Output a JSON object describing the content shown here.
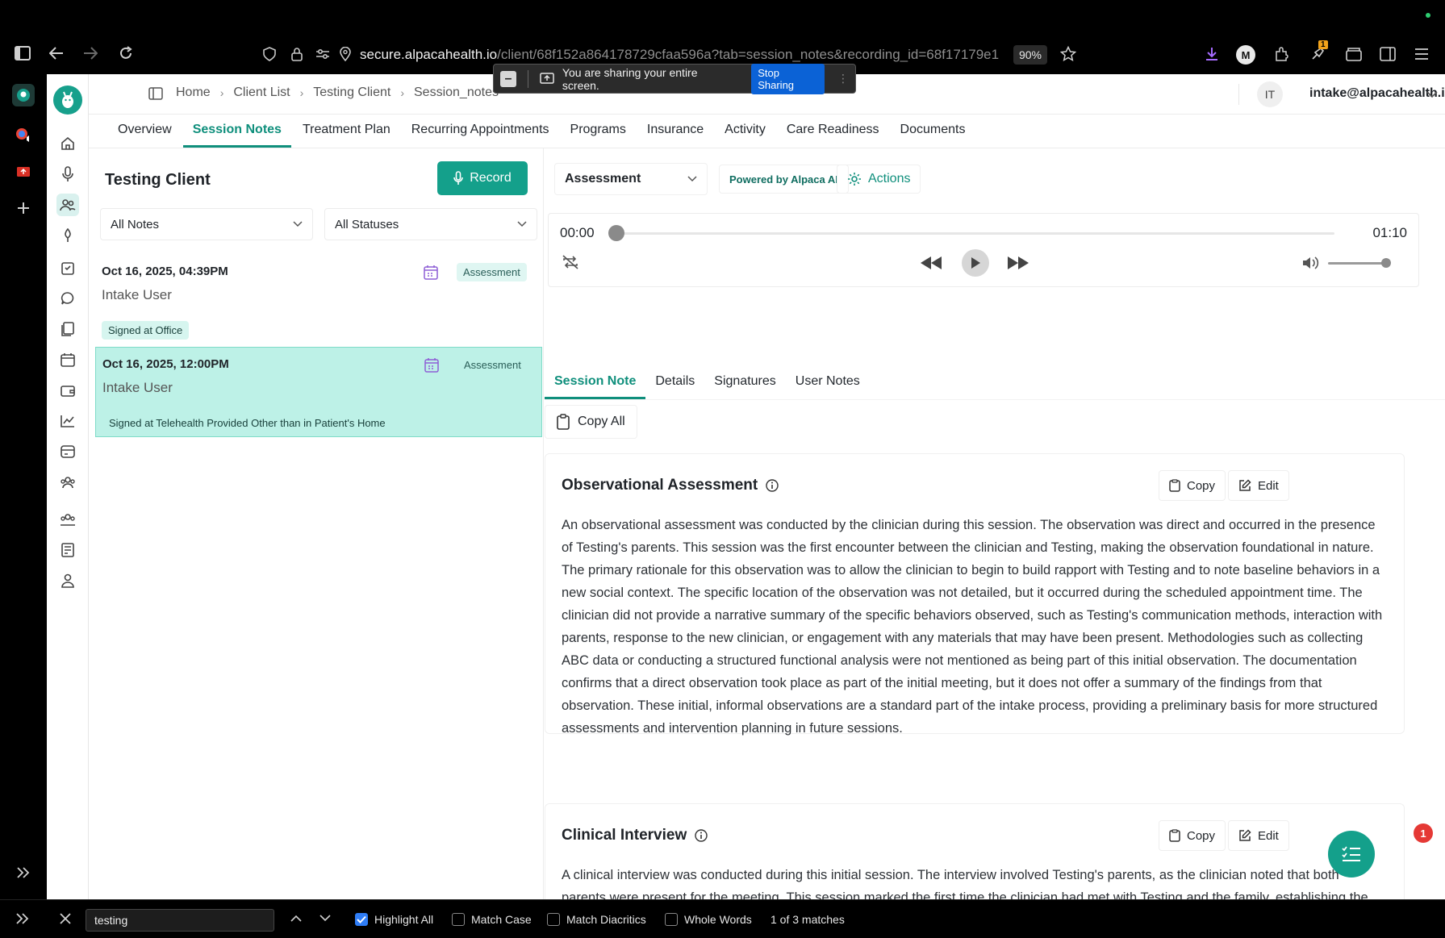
{
  "browser": {
    "url_host": "secure.alpacahealth.io",
    "url_path": "/client/68f152a864178729cfaa596a?tab=session_notes&recording_id=68f17179e1",
    "zoom": "90%",
    "profile_initial": "M",
    "extension_badge": "1"
  },
  "sharing": {
    "message": "You are sharing your entire screen.",
    "stop_label": "Stop Sharing"
  },
  "breadcrumb": {
    "home": "Home",
    "client_list": "Client List",
    "client": "Testing Client",
    "page": "Session_notes"
  },
  "user": {
    "initials": "IT",
    "email": "intake@alpacahealth.io"
  },
  "tabs": [
    {
      "label": "Overview"
    },
    {
      "label": "Session Notes"
    },
    {
      "label": "Treatment Plan"
    },
    {
      "label": "Recurring Appointments"
    },
    {
      "label": "Programs"
    },
    {
      "label": "Insurance"
    },
    {
      "label": "Activity"
    },
    {
      "label": "Care Readiness"
    },
    {
      "label": "Documents"
    }
  ],
  "left": {
    "client_name": "Testing Client",
    "record_label": "Record",
    "notes_filter": "All Notes",
    "status_filter": "All Statuses",
    "notes": [
      {
        "date": "Oct 16, 2025, 04:39PM",
        "user": "Intake User",
        "type": "Assessment",
        "status": "Signed at Office"
      },
      {
        "date": "Oct 16, 2025, 12:00PM",
        "user": "Intake User",
        "type": "Assessment",
        "status": "Signed at Telehealth Provided Other than in Patient's Home"
      }
    ]
  },
  "right": {
    "note_type": "Assessment",
    "powered_by": "Powered by Alpaca AI",
    "actions_label": "Actions",
    "player": {
      "current": "00:00",
      "duration": "01:10",
      "progress": 0.0,
      "volume": 1.0
    },
    "subtabs": [
      {
        "label": "Session Note"
      },
      {
        "label": "Details"
      },
      {
        "label": "Signatures"
      },
      {
        "label": "User Notes"
      }
    ],
    "copy_all_label": "Copy All",
    "copy_label": "Copy",
    "edit_label": "Edit",
    "sections": [
      {
        "title": "Observational Assessment",
        "body": "An observational assessment was conducted by the clinician during this session. The observation was direct and occurred in the presence of Testing's parents. This session was the first encounter between the clinician and Testing, making the observation foundational in nature. The primary rationale for this observation was to allow the clinician to begin to build rapport with Testing and to note baseline behaviors in a new social context. The specific location of the observation was not detailed, but it occurred during the scheduled appointment time. The clinician did not provide a narrative summary of the specific behaviors observed, such as Testing's communication methods, interaction with parents, response to the new clinician, or engagement with any materials that may have been present. Methodologies such as collecting ABC data or conducting a structured functional analysis were not mentioned as being part of this initial observation. The documentation confirms that a direct observation took place as part of the initial meeting, but it does not offer a summary of the findings from that observation. These initial, informal observations are a standard part of the intake process, providing a preliminary basis for more structured assessments and intervention planning in future sessions."
      },
      {
        "title": "Clinical Interview",
        "body": "A clinical interview was conducted during this initial session. The interview involved Testing's parents, as the clinician noted that both parents were present for the meeting. This session marked the first time the clinician had met with Testing and the family, establishing the foundational context for the therapeutic relationship. The interview served as the primary method for"
      }
    ]
  },
  "chat": {
    "badge": "1"
  },
  "findbar": {
    "query": "testing",
    "highlight_all": "Highlight All",
    "match_case": "Match Case",
    "match_diacritics": "Match Diacritics",
    "whole_words": "Whole Words",
    "result": "1 of 3 matches"
  },
  "colors": {
    "accent": "#14a08b",
    "accent_dark": "#0f8f7c",
    "selected_note": "#bdf1e7"
  }
}
